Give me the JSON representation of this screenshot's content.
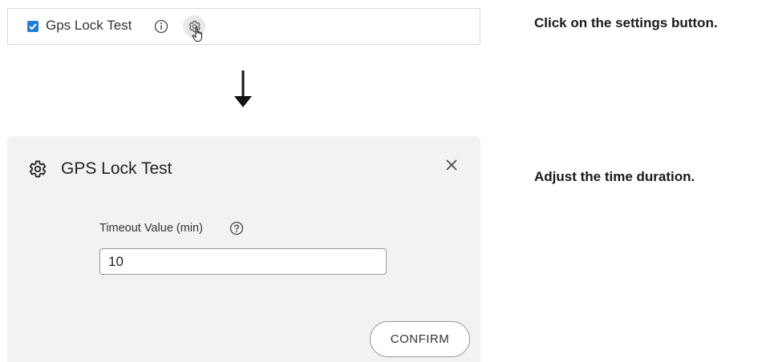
{
  "row": {
    "checkbox_checked": true,
    "label": "Gps Lock Test",
    "icons": {
      "info": "info-icon",
      "settings": "gear-icon",
      "cursor": "hand-pointer-icon"
    }
  },
  "flow": {
    "arrow_icon": "down-arrow-icon"
  },
  "instructions": {
    "step1": "Click on the settings button.",
    "step2": "Adjust the time duration."
  },
  "dialog": {
    "icon": "gear-icon",
    "title": "GPS Lock Test",
    "close_icon": "close-icon",
    "field_label": "Timeout Value (min)",
    "help_icon": "question-circle-icon",
    "timeout_value": "10",
    "confirm_label": "CONFIRM"
  },
  "colors": {
    "checkbox": "#1f7ed6",
    "dialog_bg": "#f2f2f2",
    "gear_highlight": "#e9e9e9"
  }
}
